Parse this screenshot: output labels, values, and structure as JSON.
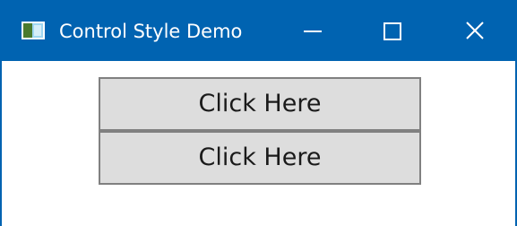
{
  "window": {
    "title": "Control Style Demo",
    "accent_color": "#0063b1",
    "app_icon": "app-window-icon",
    "caption_buttons": [
      "minimize-icon",
      "maximize-icon",
      "close-icon"
    ]
  },
  "buttons": [
    {
      "label": "Click Here"
    },
    {
      "label": "Click Here"
    }
  ]
}
